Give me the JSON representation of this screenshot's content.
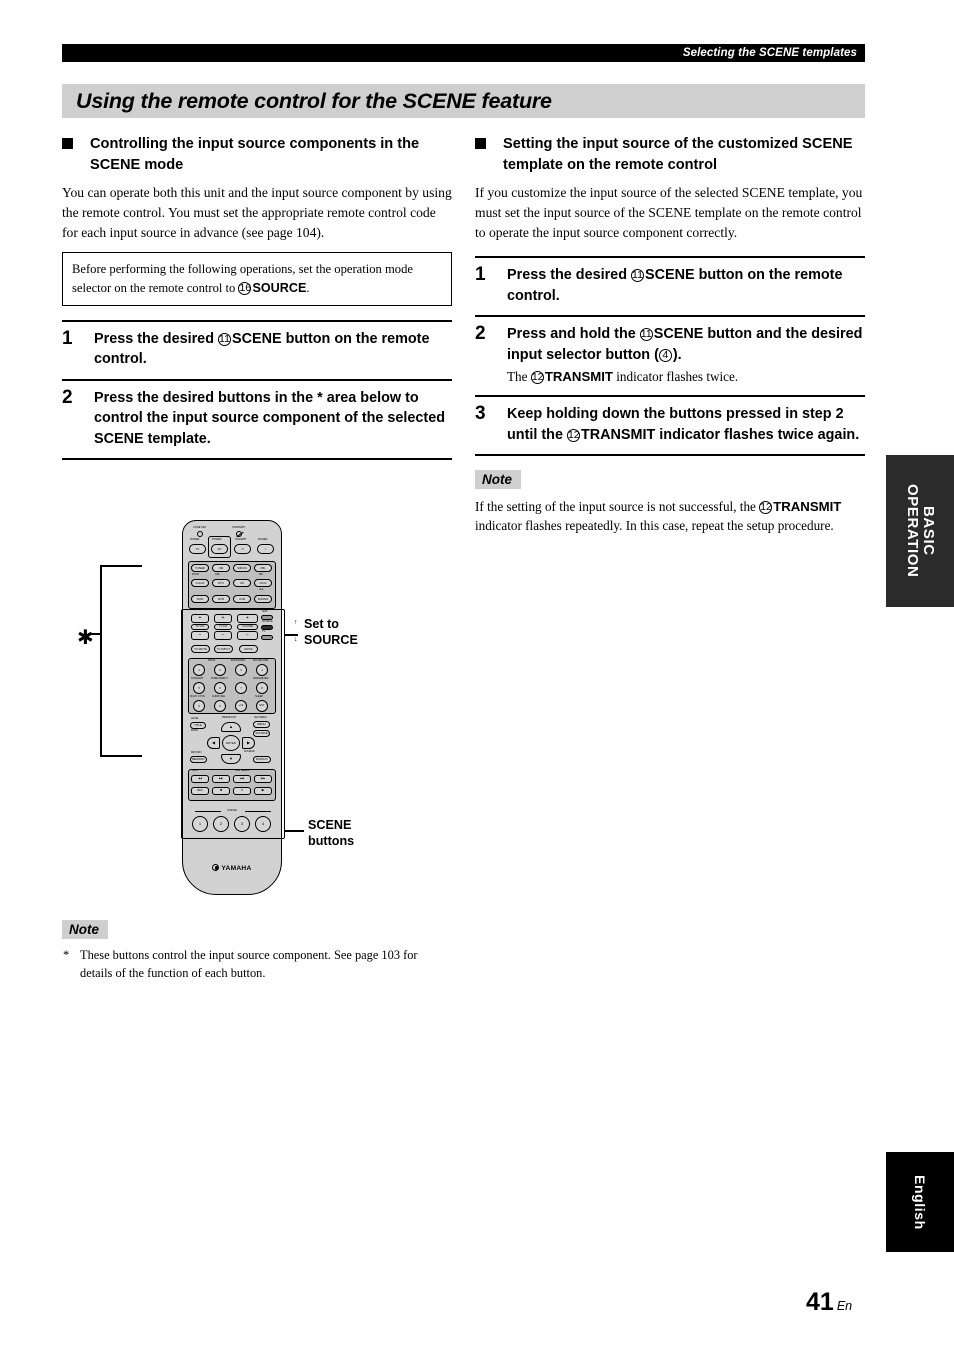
{
  "header": {
    "running_title": "Selecting the SCENE templates"
  },
  "page_title": "Using the remote control for the SCENE feature",
  "left": {
    "section_heading": "Controlling the input source components in the SCENE mode",
    "intro": "You can operate both this unit and the input source component by using the remote control. You must set the appropriate remote control code for each input source in advance (see page 104).",
    "boxed_note_pre": "Before performing the following operations, set the operation mode selector on the remote control to ",
    "boxed_note_circle": "16",
    "boxed_note_bold": "SOURCE",
    "boxed_note_post": ".",
    "steps": [
      {
        "num": "1",
        "pre": "Press the desired ",
        "circle": "11",
        "bold": "SCENE",
        "post": " button on the remote control."
      },
      {
        "num": "2",
        "pre": "Press the desired buttons in the * area below to control the input source component of the selected SCENE template.",
        "circle": "",
        "bold": "",
        "post": ""
      }
    ],
    "note_label": "Note",
    "footnote_marker": "*",
    "footnote": "These buttons control the input source component. See page 103 for details of the function of each button."
  },
  "right": {
    "section_heading": "Setting the input source of the customized SCENE template on the remote control",
    "intro": "If you customize the input source of the selected SCENE template, you must set the input source of the SCENE template on the remote control to operate the input source component correctly.",
    "steps": [
      {
        "num": "1",
        "pre": "Press the desired ",
        "circle": "11",
        "bold": "SCENE",
        "post": " button on the remote control.",
        "sub_pre": "",
        "sub_circle": "",
        "sub_bold": "",
        "sub_post": ""
      },
      {
        "num": "2",
        "pre": "Press and hold the ",
        "circle": "11",
        "bold": "SCENE",
        "post": " button and the desired input selector button (⓪).",
        "post_alt": " button and the desired input selector button (",
        "post_circle": "4",
        "post_end": ").",
        "sub_pre": "The ",
        "sub_circle": "12",
        "sub_bold": "TRANSMIT",
        "sub_post": " indicator flashes twice."
      },
      {
        "num": "3",
        "pre": "Keep holding down the buttons pressed in step 2 until the ",
        "circle": "12",
        "bold": "TRANSMIT",
        "post": " indicator flashes twice again.",
        "sub_pre": "",
        "sub_circle": "",
        "sub_bold": "",
        "sub_post": ""
      }
    ],
    "note_label": "Note",
    "note_pre": "If the setting of the input source is not successful, the ",
    "note_circle": "12",
    "note_bold": "TRANSMIT",
    "note_post": " indicator flashes repeatedly. In this case, repeat the setup procedure."
  },
  "figure": {
    "callout_set_to": "Set to\nSOURCE",
    "callout_set_to_line1": "Set to",
    "callout_set_to_line2": "SOURCE",
    "callout_scene_line1": "SCENE",
    "callout_scene_line2": "buttons",
    "asterisk": "✱",
    "brand": "YAMAHA",
    "scene_label": "SCENE",
    "top_labels": {
      "code_set": "CODE SET",
      "transmit": "TRANSMIT"
    },
    "power_row_labels": [
      "POWER",
      "POWER",
      "STANDBY",
      "POWER"
    ],
    "power_row_keys": [
      "TV",
      "AV",
      "⏻",
      "I"
    ],
    "source_keys": [
      [
        "TUNER",
        "XM",
        "SIRIUS",
        "CBL"
      ],
      [
        "V-AUX",
        "DTV",
        "CD",
        "CD-R"
      ],
      [
        "DVD",
        "DVR",
        "VCR",
        "PHONO"
      ]
    ],
    "source_over_labels": [
      "DOCK",
      "CRL",
      "MD"
    ],
    "volume_block": {
      "plus": "+",
      "minus": "−",
      "labels": [
        "TV VOL",
        "TV CH",
        "VOLUME"
      ]
    },
    "mode_labels": [
      "AMP",
      "SOURCE",
      "TV"
    ],
    "row_mute": [
      "TV MUTE",
      "TV INPUT",
      "MUTE"
    ],
    "numeric_top_labels": [
      "PROG",
      "ENHANCER",
      "B/A DECODE"
    ],
    "numeric_keys": [
      [
        "1",
        "2",
        "3",
        "4"
      ],
      [
        "5",
        "6",
        "7",
        "8"
      ],
      [
        "9",
        "0",
        "+10"
      ]
    ],
    "numeric_over_labels": [
      "STRAIGHT",
      "PURE DIRECT",
      "PARAMETER",
      "MULTI CH IN",
      "AUDIO SEL",
      "SLEEP"
    ],
    "nav_labels": {
      "level": "LEVEL",
      "title": "TITLE",
      "band": "BAND",
      "preset": "PRESET/CH",
      "set_menu": "SET MENU",
      "menu": "MENU",
      "enter": "ENTER",
      "return": "RETURN",
      "memory": "MEMORY",
      "display": "DISPLAY",
      "source": "SOURCE"
    },
    "transport_labels": {
      "info": "INFO",
      "pre_select": "PRE SELECT"
    },
    "transport_keys": [
      "◀◀",
      "▶▶",
      "◀◀|",
      "|▶▶",
      "REC",
      "■",
      "⏸",
      "▶"
    ],
    "scene_buttons": [
      "1",
      "2",
      "3",
      "4"
    ]
  },
  "side_tabs": {
    "basic": "BASIC\nOPERATION",
    "basic_line1": "BASIC",
    "basic_line2": "OPERATION",
    "english": "English"
  },
  "page_number": {
    "number": "41",
    "suffix": "En"
  },
  "colors": {
    "title_band": "#cfcfcf",
    "header_bar": "#000000",
    "tab_basic": "#2b2b2b",
    "tab_english": "#000000"
  }
}
